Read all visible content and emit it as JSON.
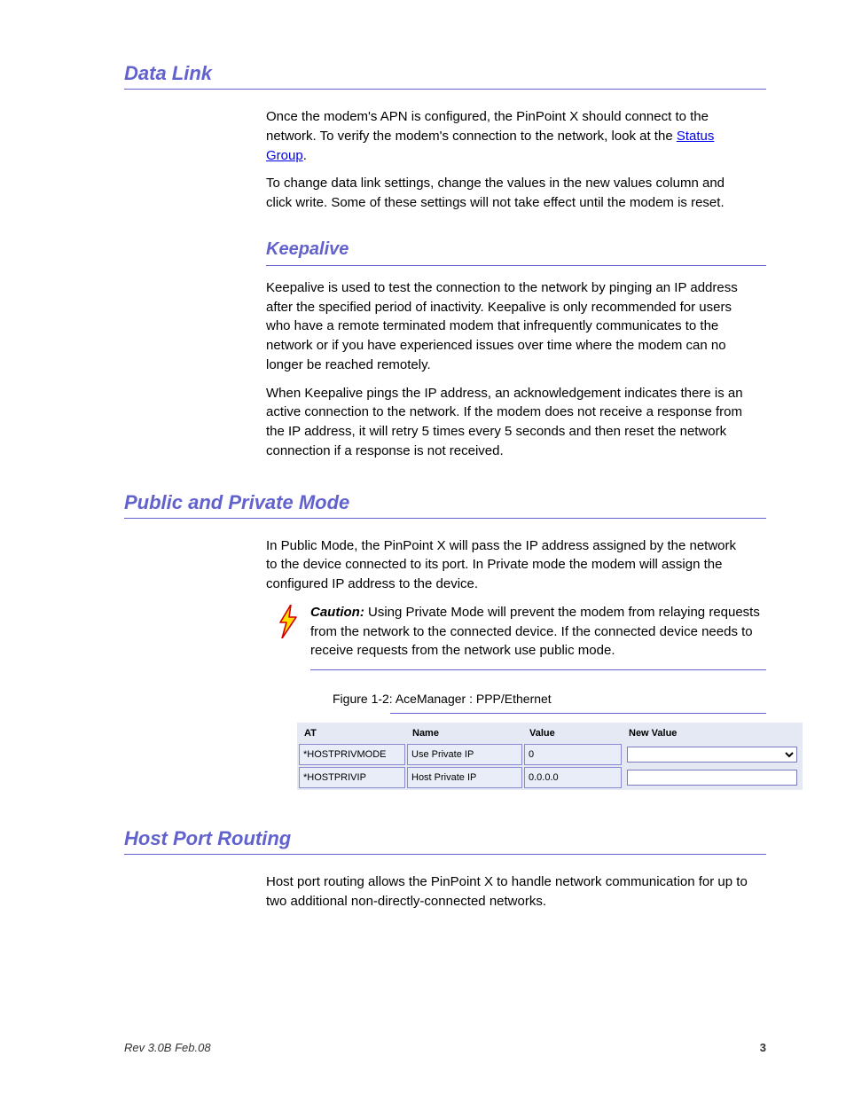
{
  "section1": {
    "title": "Data Link",
    "p1_a": "Once the modem's APN is configured, the PinPoint X should connect to the network. To verify the modem's connection to the network, look at the ",
    "p1_link": "Status Group",
    "p1_b": ".",
    "p2": "To change data link settings, change the values in the new values column and click write. Some of these settings will not take effect until the modem is reset.",
    "sub": {
      "title": "Keepalive",
      "p1": "Keepalive is used to test the connection to the network by pinging an IP address after the specified period of inactivity. Keepalive is only recommended for users who have a remote terminated modem that infrequently communicates to the network or if you have experienced issues over time where the modem can no longer be reached remotely.",
      "p2": "When Keepalive pings the IP address, an acknowledgement indicates there is an active connection to the network. If the modem does not receive a response from the IP address, it will retry 5 times every 5 seconds and then reset the network connection if a response is not received."
    }
  },
  "section2": {
    "title": "Public and Private Mode",
    "p1": "In Public Mode, the PinPoint X will pass the IP address assigned by the network to the device connected to its port. In Private mode the modem will assign the configured IP address to the device.",
    "caution": {
      "label": "Caution:",
      "text": " Using Private Mode will prevent the modem from relaying requests from the network to the connected device. If the connected device needs to receive requests from the network use public mode."
    },
    "figure": {
      "caption": "Figure 1-2: AceManager : PPP/Ethernet",
      "headers": [
        "AT",
        "Name",
        "Value",
        "New Value"
      ],
      "rows": [
        {
          "at": "*HOSTPRIVMODE",
          "name": "Use Private IP",
          "value": "0",
          "input_type": "select"
        },
        {
          "at": "*HOSTPRIVIP",
          "name": "Host Private IP",
          "value": "0.0.0.0",
          "input_type": "text"
        }
      ]
    }
  },
  "section3": {
    "title": "Host Port Routing",
    "p1": "Host port routing allows the PinPoint X to handle network communication for up to two additional non-directly-connected networks."
  },
  "footer": {
    "left": "Rev 3.0B Feb.08",
    "right": "3"
  }
}
